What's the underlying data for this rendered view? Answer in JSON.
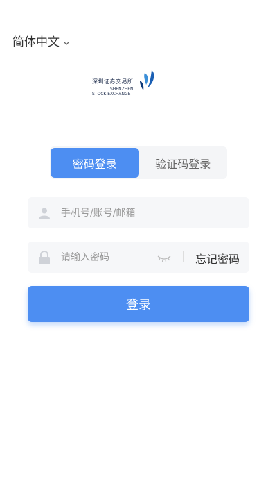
{
  "language": {
    "label": "简体中文",
    "icon": "chevron-down-icon"
  },
  "logo": {
    "text_cn": "深圳证券交易所",
    "text_en_line1": "SHENZHEN",
    "text_en_line2": "STOCK EXCHANGE"
  },
  "tabs": [
    {
      "label": "密码登录",
      "active": true
    },
    {
      "label": "验证码登录",
      "active": false
    }
  ],
  "account_field": {
    "placeholder": "手机号/账号/邮箱",
    "value": "",
    "icon": "user-icon"
  },
  "password_field": {
    "placeholder": "请输入密码",
    "value": "",
    "icon": "lock-icon",
    "toggle_icon": "eye-closed-icon"
  },
  "forgot_password": "忘记密码",
  "login_button": "登录",
  "colors": {
    "accent": "#4d8ef2",
    "field_bg": "#f6f7f9",
    "tab_bg": "#f4f5f7"
  }
}
